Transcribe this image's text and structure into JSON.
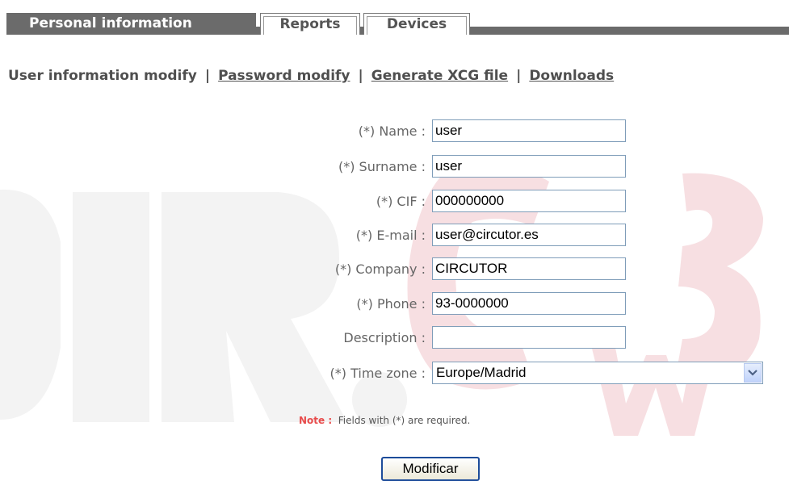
{
  "tabs": [
    {
      "label": "Personal information",
      "active": true
    },
    {
      "label": "Reports",
      "active": false
    },
    {
      "label": "Devices",
      "active": false
    }
  ],
  "subnav": {
    "current": "User information modify",
    "links": [
      "Password modify",
      "Generate XCG file",
      "Downloads"
    ],
    "separator": "|"
  },
  "form": {
    "name": {
      "label": "(*) Name :",
      "value": "user"
    },
    "surname": {
      "label": "(*) Surname :",
      "value": "user"
    },
    "cif": {
      "label": "(*) CIF :",
      "value": "000000000"
    },
    "email": {
      "label": "(*) E-mail :",
      "value": "user@circutor.es"
    },
    "company": {
      "label": "(*) Company :",
      "value": "CIRCUTOR"
    },
    "phone": {
      "label": "(*) Phone :",
      "value": "93-0000000"
    },
    "description": {
      "label": "Description :",
      "value": ""
    },
    "timezone": {
      "label": "(*) Time zone :",
      "value": "Europe/Madrid"
    }
  },
  "note": {
    "prefix": "Note :",
    "text": "Fields with (*) are required."
  },
  "submit_label": "Modificar",
  "colors": {
    "tab_active": "#6b6b6b",
    "note_red": "#e84c4c",
    "watermark_red": "#f6d6da",
    "watermark_grey": "#f0f0f0"
  },
  "icons": {
    "select_arrow": "chevron-down-icon"
  }
}
